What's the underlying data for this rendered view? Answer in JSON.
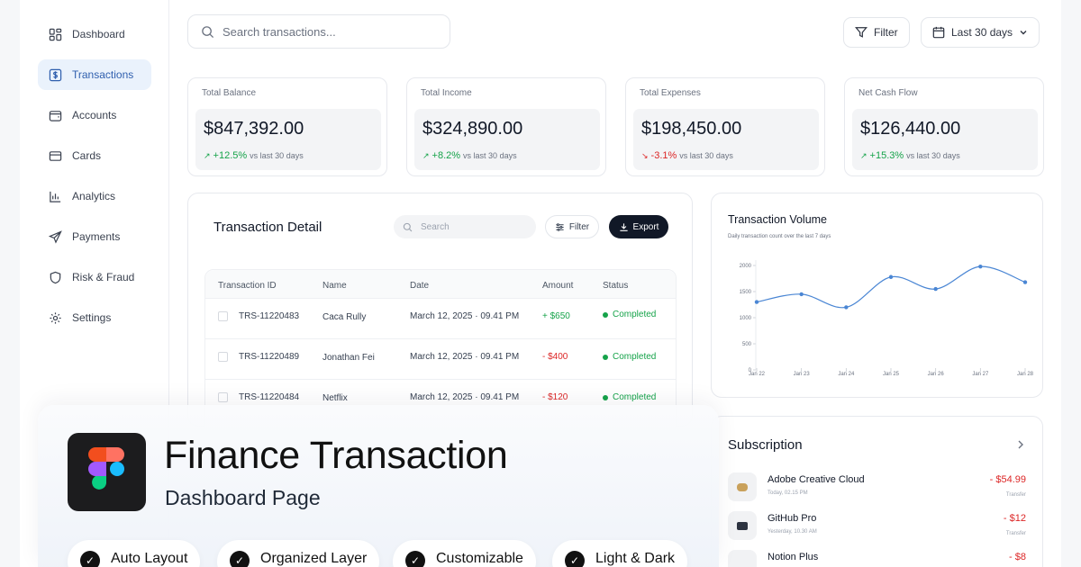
{
  "sidebar": {
    "items": [
      {
        "label": "Dashboard",
        "icon": "dashboard-icon"
      },
      {
        "label": "Transactions",
        "icon": "dollar-icon",
        "active": true
      },
      {
        "label": "Accounts",
        "icon": "wallet-icon"
      },
      {
        "label": "Cards",
        "icon": "card-icon"
      },
      {
        "label": "Analytics",
        "icon": "bar-chart-icon"
      },
      {
        "label": "Payments",
        "icon": "send-icon"
      },
      {
        "label": "Risk & Fraud",
        "icon": "shield-icon"
      },
      {
        "label": "Settings",
        "icon": "gear-icon"
      }
    ]
  },
  "header": {
    "search_placeholder": "Search transactions...",
    "filter_label": "Filter",
    "date_range_label": "Last 30 days"
  },
  "kpis": [
    {
      "title": "Total Balance",
      "value": "$847,392.00",
      "delta": "+12.5%",
      "note": "vs last 30 days",
      "trend": "up"
    },
    {
      "title": "Total Income",
      "value": "$324,890.00",
      "delta": "+8.2%",
      "note": "vs last 30 days",
      "trend": "up"
    },
    {
      "title": "Total Expenses",
      "value": "$198,450.00",
      "delta": "-3.1%",
      "note": "vs last 30 days",
      "trend": "down"
    },
    {
      "title": "Net Cash Flow",
      "value": "$126,440.00",
      "delta": "+15.3%",
      "note": "vs last 30 days",
      "trend": "up"
    }
  ],
  "transactions": {
    "title": "Transaction Detail",
    "search_placeholder": "Search",
    "filter_label": "Filter",
    "export_label": "Export",
    "columns": [
      "Transaction ID",
      "Name",
      "Date",
      "Amount",
      "Status"
    ],
    "rows": [
      {
        "id": "TRS-11220483",
        "name": "Caca Rully",
        "date": "March 12, 2025 · 09.41 PM",
        "amount": "+ $650",
        "status": "Completed",
        "positive": true
      },
      {
        "id": "TRS-11220489",
        "name": "Jonathan Fei",
        "date": "March 12, 2025 · 09.41 PM",
        "amount": "- $400",
        "status": "Completed",
        "positive": false
      },
      {
        "id": "TRS-11220484",
        "name": "Netflix",
        "date": "March 12, 2025 · 09.41 PM",
        "amount": "- $120",
        "status": "Completed",
        "positive": false
      }
    ]
  },
  "volume": {
    "title": "Transaction Volume",
    "subtitle": "Daily transaction count over the last 7 days"
  },
  "chart_data": {
    "type": "line",
    "title": "Transaction Volume",
    "subtitle": "Daily transaction count over the last 7 days",
    "x": [
      "Jan 22",
      "Jan 23",
      "Jan 24",
      "Jan 25",
      "Jan 26",
      "Jan 27",
      "Jan 28"
    ],
    "series": [
      {
        "values": [
          1300,
          1450,
          1200,
          1780,
          1550,
          1980,
          1680
        ]
      }
    ],
    "yticks": [
      0,
      500,
      1000,
      1500,
      2000
    ],
    "ylim": [
      0,
      2000
    ],
    "grid": false,
    "color": "#4a86d4"
  },
  "subscription": {
    "title": "Subscription",
    "items": [
      {
        "name": "Adobe Creative Cloud",
        "time": "Today, 02.15 PM",
        "amount": "- $54.99",
        "type": "Transfer"
      },
      {
        "name": "GitHub Pro",
        "time": "Yesterday, 10.30 AM",
        "amount": "- $12",
        "type": "Transfer"
      },
      {
        "name": "Notion Plus",
        "time": "",
        "amount": "- $8",
        "type": ""
      }
    ]
  },
  "promo": {
    "title": "Finance Transaction",
    "subtitle": "Dashboard Page",
    "features": [
      "Auto Layout",
      "Organized Layer",
      "Customizable",
      "Light & Dark"
    ]
  },
  "colors": {
    "accent": "#2f5fae",
    "positive": "#16a34a",
    "negative": "#dc2626",
    "dark_button": "#111827"
  }
}
